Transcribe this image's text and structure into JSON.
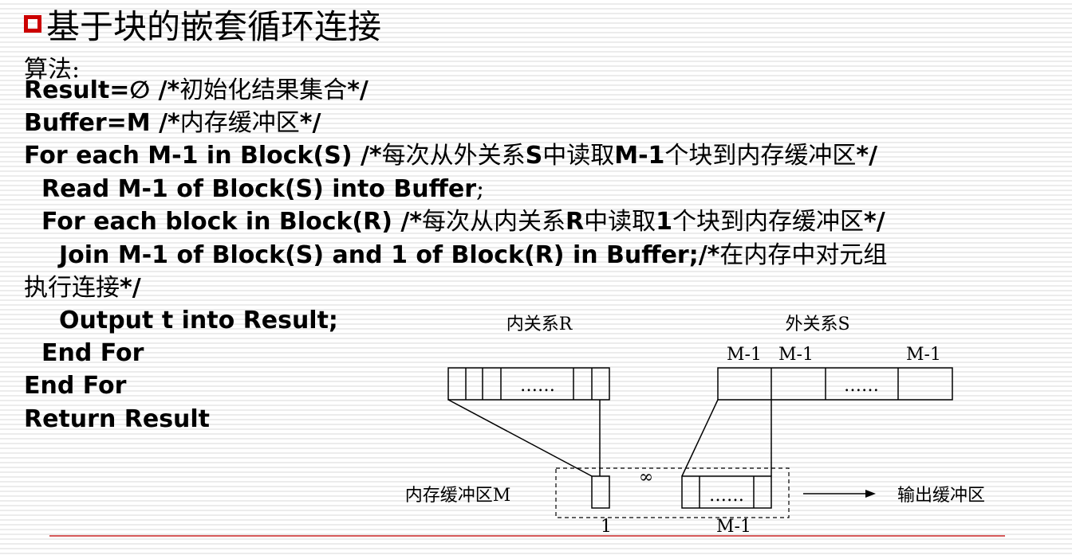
{
  "slide": {
    "title": "基于块的嵌套循环连接",
    "algorithm_label": "算法:"
  },
  "code": {
    "line1": {
      "code": "Result=∅ /*",
      "comment": "初始化结果集合",
      "end": "*/"
    },
    "line2": {
      "code": "Buffer=M /*",
      "comment": "内存缓冲区",
      "end": "*/"
    },
    "line3": {
      "code": "For each M-1 in Block(S) /*",
      "comment1": "每次从外关系",
      "s": "S",
      "comment2": "中读取",
      "m1": "M-1",
      "comment3": "个块到内存缓冲区",
      "end": "*/"
    },
    "line4": {
      "code": "Read M-1 of Block(S) into Buffer",
      "end": ";"
    },
    "line5": {
      "code": "For each block in Block(R) /*",
      "comment1": "每次从内关系",
      "r": "R",
      "comment2": "中读取",
      "one": "1",
      "comment3": "个块到内存缓冲区",
      "end": "*/"
    },
    "line6": {
      "code": "Join M-1 of Block(S) and 1 of Block(R) in Buffer;/*",
      "comment": "在内存中对元组"
    },
    "line7": {
      "comment": "执行连接",
      "end": "*/"
    },
    "line8": "Output t into Result;",
    "line9": "End For",
    "line10": "End For",
    "line11": "Return Result"
  },
  "diagram": {
    "inner_relation_label": "内关系R",
    "outer_relation_label": "外关系S",
    "outer_block_labels": [
      "M-1",
      "M-1",
      "M-1"
    ],
    "inner_ellipsis": "……",
    "outer_ellipsis": "……",
    "buffer_label": "内存缓冲区M",
    "buffer_ellipsis": "……",
    "join_symbol": "∞",
    "inner_buffer_count": "1",
    "outer_buffer_count": "M-1",
    "output_label": "输出缓冲区"
  }
}
